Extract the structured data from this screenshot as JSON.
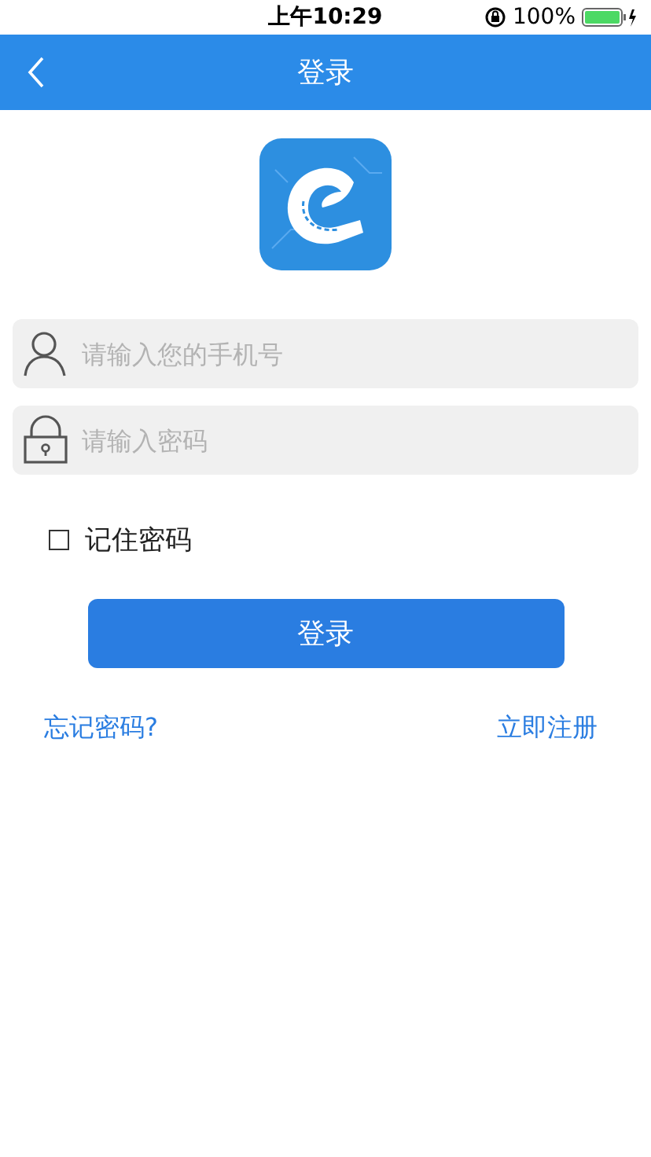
{
  "status_bar": {
    "time": "上午10:29",
    "battery": "100%"
  },
  "nav_bar": {
    "title": "登录"
  },
  "phone_field": {
    "placeholder": "请输入您的手机号"
  },
  "password_field": {
    "placeholder": "请输入密码"
  },
  "remember": {
    "label": "记住密码",
    "checked": false
  },
  "login_button": "登录",
  "links": {
    "forgot": "忘记密码?",
    "register": "立即注册"
  }
}
